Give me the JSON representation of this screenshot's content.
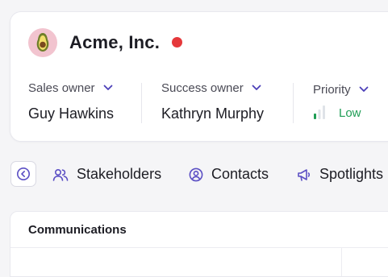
{
  "company": {
    "name": "Acme, Inc.",
    "avatar_icon": "avocado-icon",
    "status_color": "#e5383b"
  },
  "fields": {
    "sales_owner": {
      "label": "Sales owner",
      "value": "Guy Hawkins"
    },
    "success_owner": {
      "label": "Success owner",
      "value": "Kathryn Murphy"
    },
    "priority": {
      "label": "Priority",
      "value": "Low",
      "level": 1,
      "levels_total": 3,
      "color": "#1f9d55"
    }
  },
  "tabs": [
    {
      "label": "Stakeholders",
      "icon": "users-icon"
    },
    {
      "label": "Contacts",
      "icon": "user-circle-icon"
    },
    {
      "label": "Spotlights",
      "icon": "megaphone-icon"
    }
  ],
  "panel": {
    "title": "Communications"
  },
  "colors": {
    "accent": "#5b4fc4",
    "chevron": "#4b3fb8"
  }
}
